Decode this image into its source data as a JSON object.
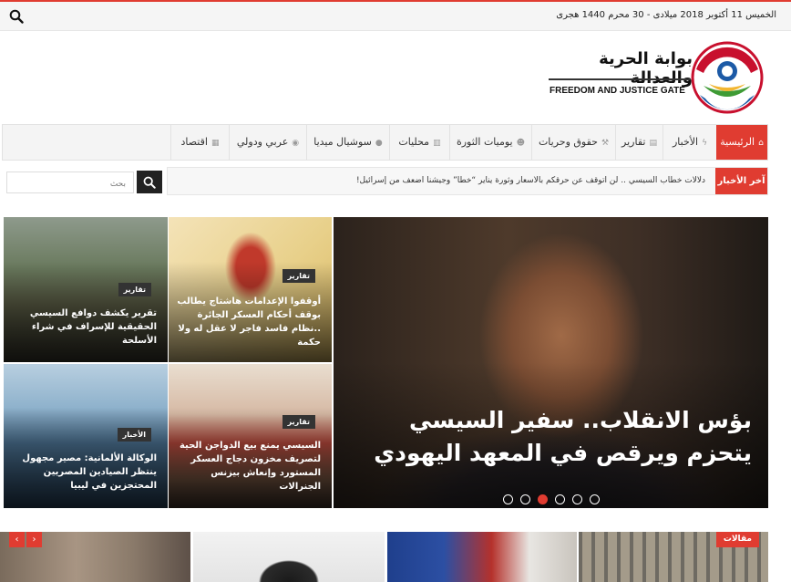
{
  "topbar": {
    "date": "الخميس 11 أكتوبر 2018 ميلادى - 30 محرم 1440 هجرى"
  },
  "header": {
    "logo_ar": "بوابة الحرية والعدالة",
    "logo_en": "FREEDOM AND JUSTICE GATE"
  },
  "nav": {
    "items": [
      {
        "label": "الرئيسية",
        "icon": "home-icon"
      },
      {
        "label": "الأخبار",
        "icon": "bolt-icon"
      },
      {
        "label": "تقارير",
        "icon": "file-icon"
      },
      {
        "label": "حقوق وحريات",
        "icon": "gavel-icon"
      },
      {
        "label": "يوميات الثورة",
        "icon": "users-icon"
      },
      {
        "label": "محليات",
        "icon": "building-icon"
      },
      {
        "label": "سوشيال ميديا",
        "icon": "comments-icon"
      },
      {
        "label": "عربي ودولي",
        "icon": "globe-icon"
      },
      {
        "label": "اقتصاد",
        "icon": "chart-icon"
      }
    ]
  },
  "ticker": {
    "label": "آخر الأخبار",
    "text": "دلالات خطاب السيسي .. لن أتوقف عن حرقكم بالأسعار وثورة يناير “خطأ” وجيشنا أضعف من إسرائيل!"
  },
  "search": {
    "placeholder": "بحث"
  },
  "slider": {
    "headline": "بؤس الانقلاب.. سفير السيسي يتحزم ويرقص في المعهد اليهودي",
    "active_slide": 3,
    "slide_count": 6
  },
  "tiles": [
    {
      "tag": "تقارير",
      "title": "أوقفوا الإعدامات هاشتاج يطالب بوقف أحكام العسكر الجائرة ..نظام فاسد فاجر لا عقل له ولا حكمة"
    },
    {
      "tag": "تقارير",
      "title": "تقرير يكشف دوافع السيسي الحقيقية للإسراف في شراء الأسلحة"
    },
    {
      "tag": "تقارير",
      "title": "السيسي يمنع بيع الدواجن الحية لتصريف مخزون دجاج العسكر المستورد وإنعاش بيزنس الجنرالات"
    },
    {
      "tag": "الأخبار",
      "title": "الوكالة الألمانية: مصير مجهول ينتظر الصيادين المصريين المحتجزين في ليبيا"
    }
  ],
  "bottom": {
    "category_badge": "مقالات",
    "prev_arrow": "‹",
    "next_arrow": "›"
  }
}
